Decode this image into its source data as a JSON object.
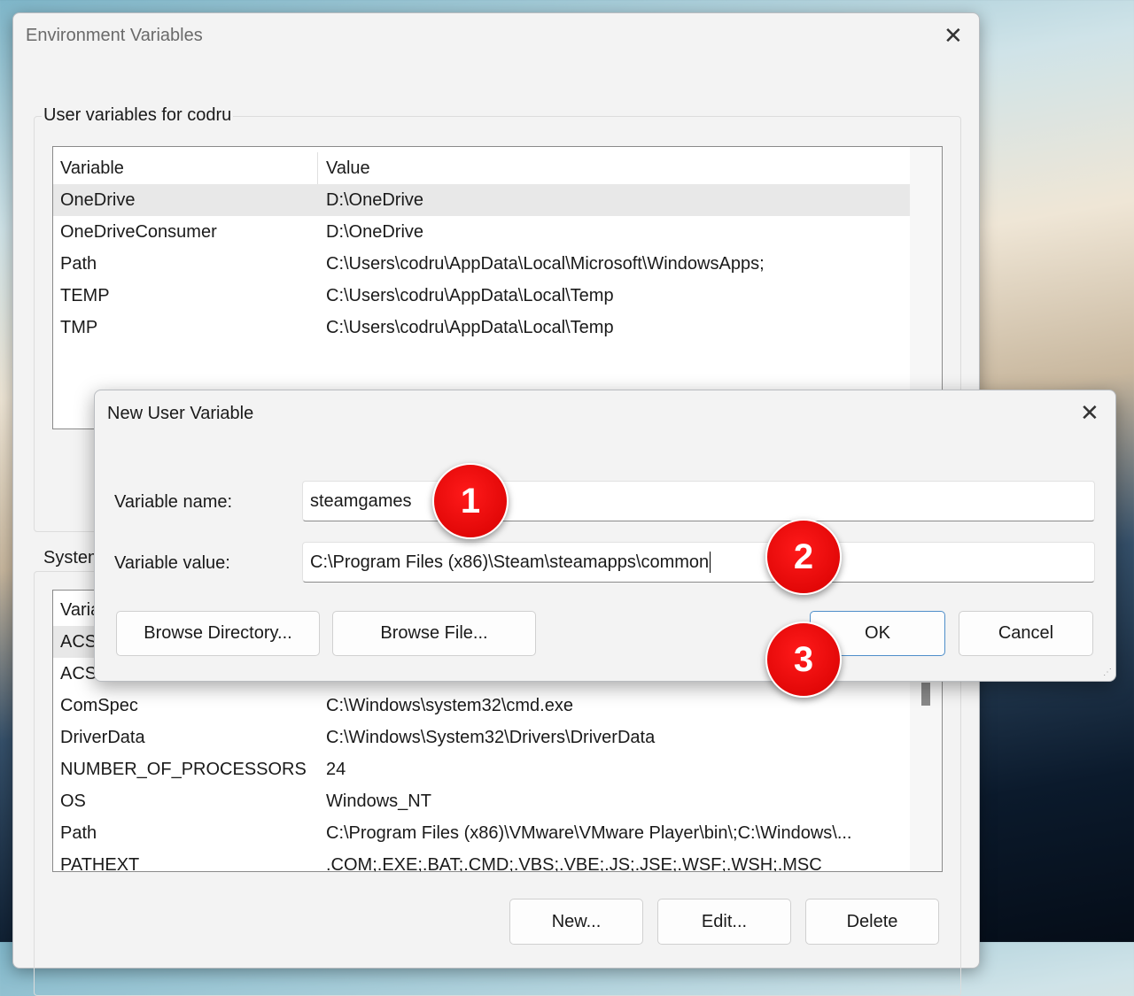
{
  "env_window": {
    "title": "Environment Variables",
    "user_group_label": "User variables for codru",
    "system_group_label": "System variables",
    "columns": [
      "Variable",
      "Value"
    ],
    "user_vars": [
      {
        "name": "OneDrive",
        "value": "D:\\OneDrive"
      },
      {
        "name": "OneDriveConsumer",
        "value": "D:\\OneDrive"
      },
      {
        "name": "Path",
        "value": "C:\\Users\\codru\\AppData\\Local\\Microsoft\\WindowsApps;"
      },
      {
        "name": "TEMP",
        "value": "C:\\Users\\codru\\AppData\\Local\\Temp"
      },
      {
        "name": "TMP",
        "value": "C:\\Users\\codru\\AppData\\Local\\Temp"
      }
    ],
    "system_vars": [
      {
        "name": "ACS",
        "value": ""
      },
      {
        "name": "ACS",
        "value": ""
      },
      {
        "name": "ComSpec",
        "value": "C:\\Windows\\system32\\cmd.exe"
      },
      {
        "name": "DriverData",
        "value": "C:\\Windows\\System32\\Drivers\\DriverData"
      },
      {
        "name": "NUMBER_OF_PROCESSORS",
        "value": "24"
      },
      {
        "name": "OS",
        "value": "Windows_NT"
      },
      {
        "name": "Path",
        "value": "C:\\Program Files (x86)\\VMware\\VMware Player\\bin\\;C:\\Windows\\..."
      },
      {
        "name": "PATHEXT",
        "value": ".COM;.EXE;.BAT;.CMD;.VBS;.VBE;.JS;.JSE;.WSF;.WSH;.MSC"
      }
    ],
    "buttons": {
      "new": "New...",
      "edit": "Edit...",
      "delete": "Delete"
    }
  },
  "dialog": {
    "title": "New User Variable",
    "name_label": "Variable name:",
    "name_value": "steamgames",
    "value_label": "Variable value:",
    "value_value": "C:\\Program Files (x86)\\Steam\\steamapps\\common",
    "browse_dir": "Browse Directory...",
    "browse_file": "Browse File...",
    "ok": "OK",
    "cancel": "Cancel"
  },
  "badges": [
    "1",
    "2",
    "3"
  ],
  "colors": {
    "badge": "#e00000",
    "ok_border": "#4f8ec9"
  }
}
